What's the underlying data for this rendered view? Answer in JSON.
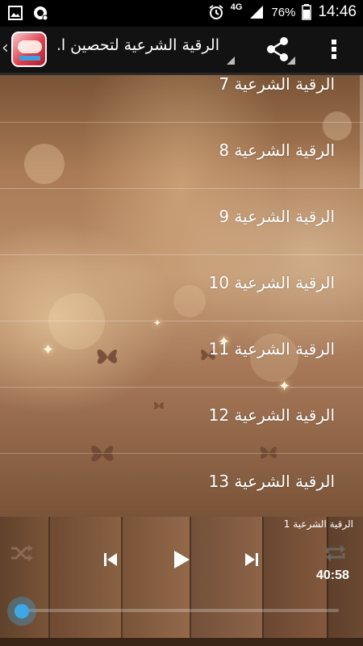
{
  "status_bar": {
    "network": "4G",
    "battery": "76%",
    "time": "14:46",
    "icons": [
      "gallery-icon",
      "data-saver-icon",
      "alarm-icon",
      "signal-icon",
      "battery-icon"
    ]
  },
  "app_bar": {
    "title": "الرقية الشرعية لتحصين ا..",
    "icons": [
      "app-logo",
      "share-icon",
      "overflow-menu-icon"
    ]
  },
  "list": {
    "items": [
      {
        "label": "الرقية الشرعية 7"
      },
      {
        "label": "الرقية الشرعية 8"
      },
      {
        "label": "الرقية الشرعية 9"
      },
      {
        "label": "الرقية الشرعية 10"
      },
      {
        "label": "الرقية الشرعية 11"
      },
      {
        "label": "الرقية الشرعية 12"
      },
      {
        "label": "الرقية الشرعية 13"
      }
    ]
  },
  "player": {
    "now_playing": "الرقية الشرعية 1",
    "duration": "40:58",
    "progress": 0.0,
    "controls": [
      "shuffle-icon",
      "previous-icon",
      "play-icon",
      "next-icon",
      "repeat-icon"
    ],
    "accent_color": "#3ea8e6"
  }
}
